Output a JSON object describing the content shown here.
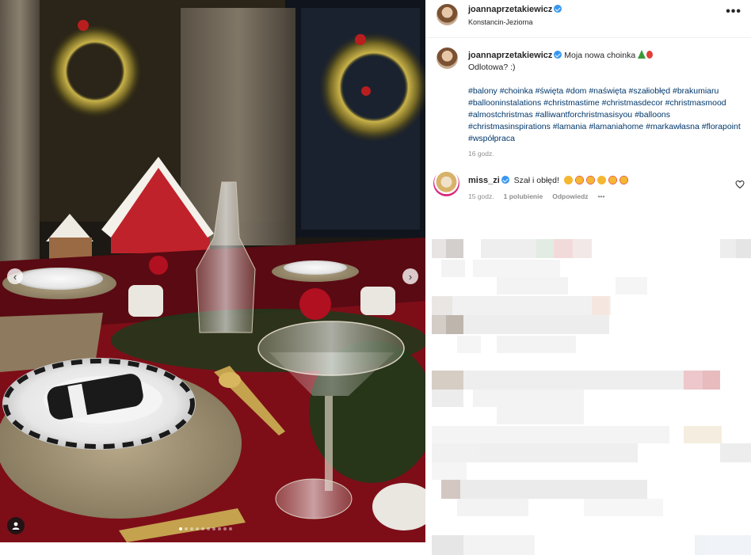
{
  "post": {
    "username": "joannaprzetakiewicz",
    "location": "Konstancin-Jeziorna",
    "more_label": "•••",
    "caption_text": "Moja nowa choinka",
    "caption_line2": "Odlotowa? :)",
    "hashtags": "#balony #choinka #święta #dom #naświęta #szałiobłęd #brakumiaru #ballooninstalations #christmastime #christmasdecor #christmasmood #almostchristmas #alliwantforchristmasisyou #balloons #christmasinspirations #lamania #lamaniahome #markawłasna #florapoint #współpraca",
    "time": "16 godz."
  },
  "comment": {
    "username": "miss_zi",
    "text": "Szał i obłęd!",
    "time": "15 godz.",
    "likes": "1 polubienie",
    "reply": "Odpowiedz",
    "more": "•••"
  },
  "carousel": {
    "total": 10,
    "active_index": 0
  },
  "icons": {
    "prev": "chevron-left-icon",
    "next": "chevron-right-icon",
    "user_tag": "user-tag-icon",
    "heart": "heart-icon",
    "verified": "verified-badge-icon"
  },
  "colors": {
    "link": "#00376b",
    "verified": "#3897f0",
    "muted": "#8e8e8e"
  }
}
